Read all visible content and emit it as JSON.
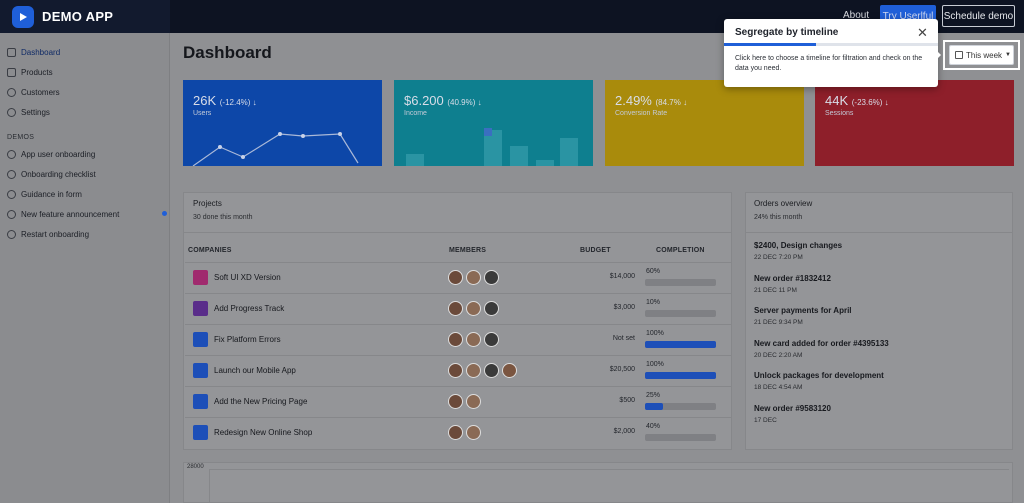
{
  "app": {
    "name": "DEMO APP"
  },
  "topnav": {
    "about": "About",
    "try_label": "Try Userlful",
    "schedule_label": "Schedule demo"
  },
  "sidebar": {
    "items": [
      {
        "label": "Dashboard",
        "icon": "home-icon"
      },
      {
        "label": "Products",
        "icon": "cart-icon"
      },
      {
        "label": "Customers",
        "icon": "users-icon"
      },
      {
        "label": "Settings",
        "icon": "gear-icon"
      }
    ],
    "section_label": "DEMOS",
    "demos": [
      {
        "label": "App user onboarding"
      },
      {
        "label": "Onboarding checklist"
      },
      {
        "label": "Guidance in form"
      },
      {
        "label": "New feature announcement"
      },
      {
        "label": "Restart onboarding"
      }
    ]
  },
  "page": {
    "title": "Dashboard",
    "filter_label": "This week"
  },
  "stats": [
    {
      "value": "26K",
      "change": "(-12.4%) ↓",
      "label": "Users",
      "color": "#0d47a8"
    },
    {
      "value": "$6.200",
      "change": "(40.9%) ↓",
      "label": "Income",
      "color": "#0e7f8f"
    },
    {
      "value": "2.49%",
      "change": "(84.7% ↓",
      "label": "Conversion Rate",
      "color": "#a98b0c"
    },
    {
      "value": "44K",
      "change": "(-23.6%) ↓",
      "label": "Sessions",
      "color": "#8e1f2a"
    }
  ],
  "projects": {
    "title": "Projects",
    "subtitle": "30 done this month",
    "columns": [
      "COMPANIES",
      "MEMBERS",
      "BUDGET",
      "COMPLETION"
    ],
    "rows": [
      {
        "name": "Soft UI XD Version",
        "budget": "$14,000",
        "completion": "60%",
        "progress": 0,
        "color": "#a02a6e",
        "members": 3
      },
      {
        "name": "Add Progress Track",
        "budget": "$3,000",
        "completion": "10%",
        "progress": 0,
        "color": "#5a2d8a",
        "members": 3
      },
      {
        "name": "Fix Platform Errors",
        "budget": "Not set",
        "completion": "100%",
        "progress": 100,
        "color": "#1d4fb8",
        "members": 3
      },
      {
        "name": "Launch our Mobile App",
        "budget": "$20,500",
        "completion": "100%",
        "progress": 100,
        "color": "#1d4fb8",
        "members": 4
      },
      {
        "name": "Add the New Pricing Page",
        "budget": "$500",
        "completion": "25%",
        "progress": 25,
        "color": "#1d4fb8",
        "members": 2
      },
      {
        "name": "Redesign New Online Shop",
        "budget": "$2,000",
        "completion": "40%",
        "progress": 0,
        "color": "#1d4fb8",
        "members": 2
      }
    ]
  },
  "orders": {
    "title": "Orders overview",
    "subtitle": "24% this month",
    "items": [
      {
        "title": "$2400, Design changes",
        "date": "22 DEC 7:20 PM"
      },
      {
        "title": "New order #1832412",
        "date": "21 DEC 11 PM"
      },
      {
        "title": "Server payments for April",
        "date": "21 DEC 9:34 PM"
      },
      {
        "title": "New card added for order #4395133",
        "date": "20 DEC 2:20 AM"
      },
      {
        "title": "Unlock packages for development",
        "date": "18 DEC 4:54 AM"
      },
      {
        "title": "New order #9583120",
        "date": "17 DEC"
      }
    ]
  },
  "bottom_chart": {
    "y_top_label": "28000"
  },
  "tooltip": {
    "title": "Segregate by timeline",
    "body": "Click here to choose a timeline for filtration and check on the data you need.",
    "progress": 0.43
  }
}
